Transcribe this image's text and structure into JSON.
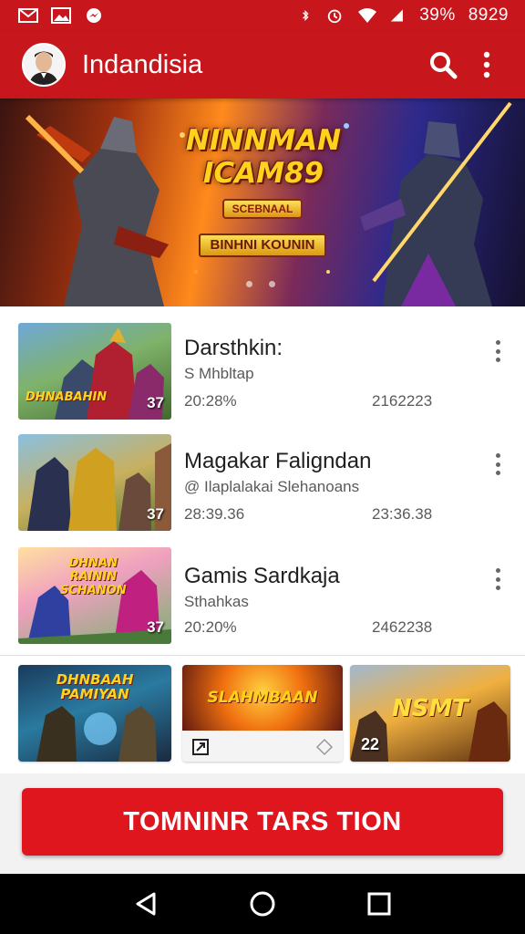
{
  "status_bar": {
    "battery_text": "39%",
    "time": "8929",
    "icons": [
      "mail-icon",
      "image-icon",
      "messenger-icon",
      "bluetooth-icon",
      "alarm-icon",
      "wifi-icon",
      "signal-icon"
    ]
  },
  "app_bar": {
    "title": "Indandisia",
    "actions": [
      "search-icon",
      "more-vert-icon"
    ]
  },
  "banner": {
    "title_line1": "NINNMAN",
    "title_line2": "ICAM89",
    "badge": "SCEBNAAL",
    "subtitle": "BINHNI KOUNIN",
    "page_count": 2,
    "active_page": 0
  },
  "list": {
    "items": [
      {
        "title": "Darsthkin:",
        "subtitle": "S Mhbltap",
        "meta_left": "20:28%",
        "meta_right": "2162223",
        "thumb_label": "DHNABAHIN",
        "thumb_badge": "37"
      },
      {
        "title": "Magakar Faligndan",
        "subtitle": "@ Ilaplalakai Slehanoans",
        "meta_left": "28:39.36",
        "meta_right": "23:36.38",
        "thumb_label": "",
        "thumb_badge": "37"
      },
      {
        "title": "Gamis Sardkaja",
        "subtitle": "Sthahkas",
        "meta_left": "20:20%",
        "meta_right": "2462238",
        "thumb_label": "DHNAN\nRAININ\nSCHANON",
        "thumb_badge": "37"
      }
    ]
  },
  "cards": [
    {
      "label": "DHNBAAH\nPAMIYAN",
      "badge": ""
    },
    {
      "label": "SLAHMBAAN",
      "badge": ""
    },
    {
      "label": "NSMT",
      "badge": "22"
    }
  ],
  "cta": {
    "label": "TOMNINR TARS TION"
  },
  "colors": {
    "primary": "#c8161d",
    "cta": "#e0161e",
    "accent_gold": "#ffd21e"
  }
}
